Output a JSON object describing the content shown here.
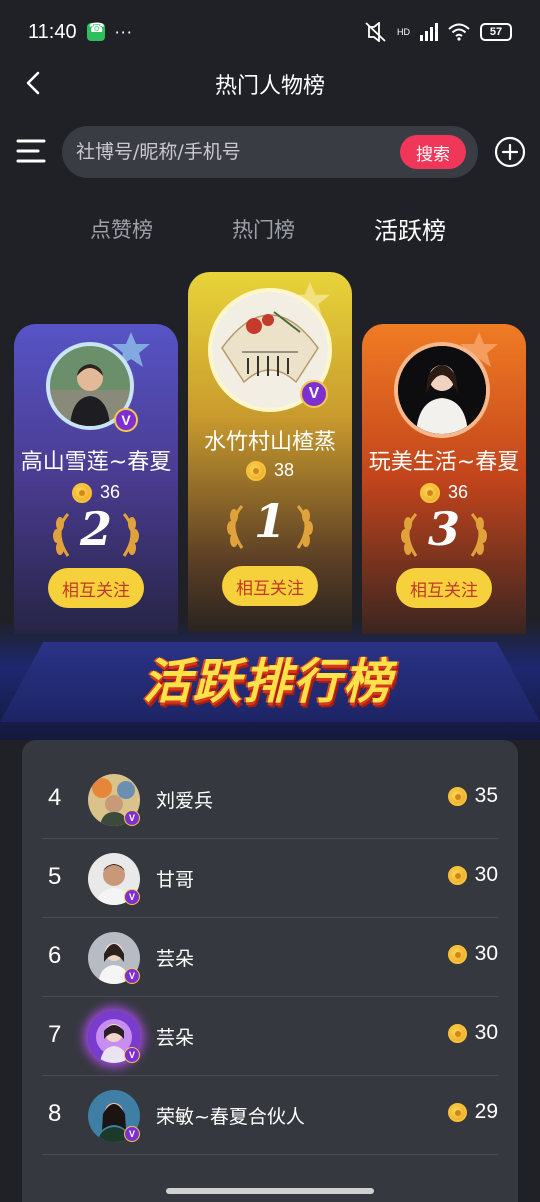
{
  "status": {
    "time": "11:40",
    "battery": "57",
    "dots": "···",
    "net": "HD"
  },
  "header": {
    "title": "热门人物榜"
  },
  "search": {
    "placeholder": "社博号/昵称/手机号",
    "button": "搜索"
  },
  "tabs": [
    {
      "label": "点赞榜",
      "active": false
    },
    {
      "label": "热门榜",
      "active": false
    },
    {
      "label": "活跃榜",
      "active": true
    }
  ],
  "podium": [
    {
      "rank": "2",
      "name": "高山雪莲~春夏",
      "score": "36",
      "follow": "相互关注"
    },
    {
      "rank": "1",
      "name": "水竹村山楂蒸",
      "score": "38",
      "follow": "相互关注"
    },
    {
      "rank": "3",
      "name": "玩美生活~春夏",
      "score": "36",
      "follow": "相互关注"
    }
  ],
  "banner": {
    "text": "活跃排行榜"
  },
  "list": [
    {
      "rank": "4",
      "name": "刘爱兵",
      "score": "35"
    },
    {
      "rank": "5",
      "name": "甘哥",
      "score": "30"
    },
    {
      "rank": "6",
      "name": "芸朵",
      "score": "30"
    },
    {
      "rank": "7",
      "name": "芸朵",
      "score": "30"
    },
    {
      "rank": "8",
      "name": "荣敏~春夏合伙人",
      "score": "29"
    }
  ],
  "badge": {
    "v": "V"
  },
  "colors": {
    "search_btn": "#f0375a",
    "follow_btn": "#f7d13b",
    "gold": "#f3c74b"
  }
}
